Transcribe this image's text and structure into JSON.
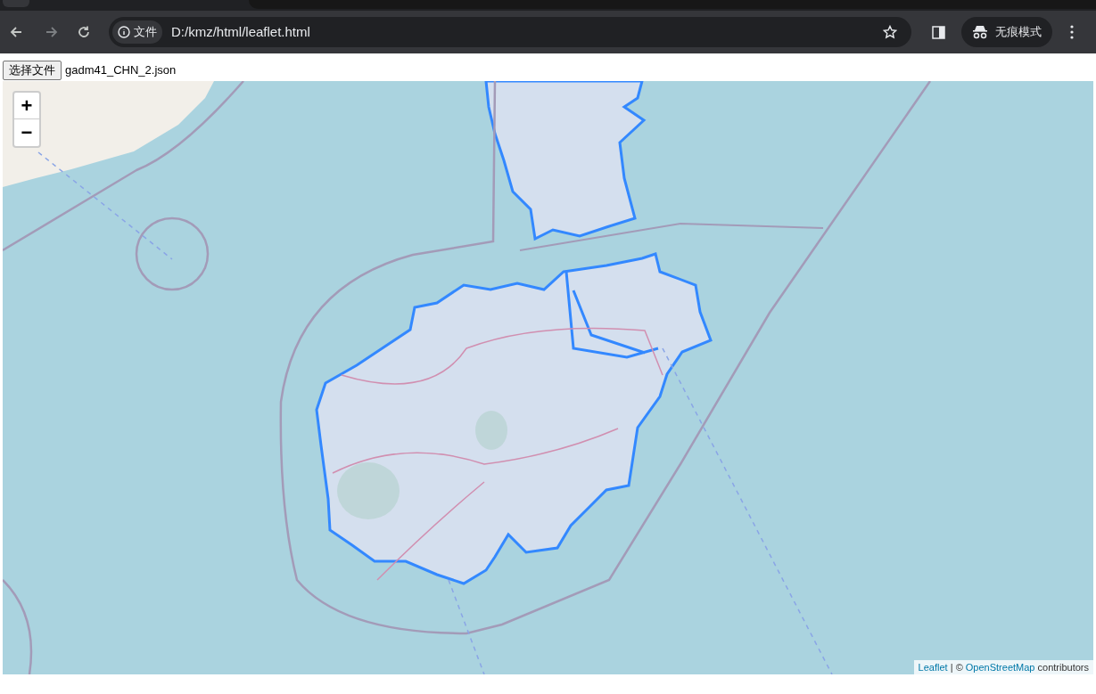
{
  "browser": {
    "address_chip": "文件",
    "url": "D:/kmz/html/leaflet.html",
    "incognito_label": "无痕模式"
  },
  "file_picker": {
    "button": "选择文件",
    "file_name": "gadm41_CHN_2.json"
  },
  "map": {
    "zoom_in": "+",
    "zoom_out": "−",
    "attribution": {
      "leaflet_link": "Leaflet",
      "separator": "|",
      "copyright": "©",
      "osm_link": "OpenStreetMap",
      "suffix": "contributors"
    }
  }
}
